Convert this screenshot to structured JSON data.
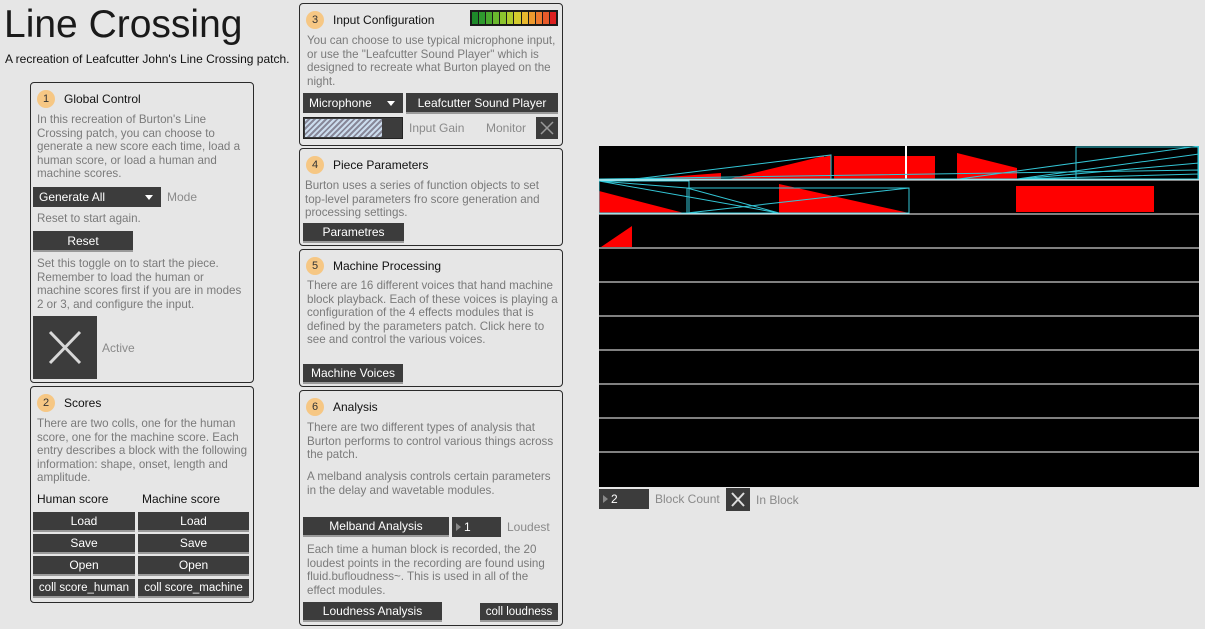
{
  "header": {
    "title": "Line Crossing",
    "subtitle": "A recreation of Leafcutter John's Line Crossing patch."
  },
  "global_control": {
    "number": "1",
    "title": "Global Control",
    "description": "In this recreation of Burton's Line Crossing patch, you can choose to generate a new score each time, load a human score, or load a human and machine scores.",
    "mode_value": "Generate All",
    "mode_label": "Mode",
    "reset_hint": "Reset to start again.",
    "reset_label": "Reset",
    "toggle_hint": "Set this toggle on to start the piece. Remember to load the human or machine scores first if you are in modes 2 or 3, and configure the input.",
    "active_label": "Active"
  },
  "scores": {
    "number": "2",
    "title": "Scores",
    "description": "There are two colls, one for the human score, one for the machine score. Each entry describes a block with the following information: shape, onset, length and amplitude.",
    "human_header": "Human score",
    "machine_header": "Machine score",
    "load": "Load",
    "save": "Save",
    "open": "Open",
    "coll_human": "coll score_human",
    "coll_machine": "coll score_machine"
  },
  "input_config": {
    "number": "3",
    "title": "Input Configuration",
    "description": "You can choose to use typical microphone input, or use the \"Leafcutter Sound Player\" which is designed to recreate what Burton played on the night.",
    "source_value": "Microphone",
    "player_label": "Leafcutter Sound Player",
    "gain_label": "Input Gain",
    "monitor_label": "Monitor",
    "meter_colors": [
      "#1e8a2a",
      "#2e9a2e",
      "#4aaa2e",
      "#6ab82e",
      "#8cc42e",
      "#b0cc2e",
      "#d4cc2e",
      "#e8b82e",
      "#ee9a2e",
      "#ee7a2e",
      "#e85a2a",
      "#dd2020"
    ]
  },
  "piece_params": {
    "number": "4",
    "title": "Piece Parameters",
    "description": "Burton uses a series of function objects to set top-level parameters fro score generation and processing settings.",
    "button_label": "Parametres"
  },
  "machine_processing": {
    "number": "5",
    "title": "Machine Processing",
    "description": "There are 16 different voices that hand machine block playback. Each of these voices is playing a configuration of the 4 effects modules that is defined by the parameters patch. Click here to see and control the various voices.",
    "button_label": "Machine Voices"
  },
  "analysis": {
    "number": "6",
    "title": "Analysis",
    "description1": "There are two different types of analysis that Burton performs to control various things across the patch.",
    "description2": "A melband analysis controls certain parameters in the delay and wavetable modules.",
    "melband_label": "Melband Analysis",
    "loudest_value": "1",
    "loudest_label": "Loudest",
    "description3": "Each time a human block is recorded, the 20 loudest points in the recording are found using fluid.bufloudness~. This is used in all of the effect modules.",
    "loudness_label": "Loudness Analysis",
    "coll_loudness": "coll loudness"
  },
  "score_view": {
    "block_count_value": "2",
    "block_count_label": "Block Count",
    "in_block_label": "In Block",
    "colors": {
      "block": "#ff0000",
      "outline": "#33c6d6",
      "lane_line": "#ffffff",
      "background": "#000000"
    }
  }
}
